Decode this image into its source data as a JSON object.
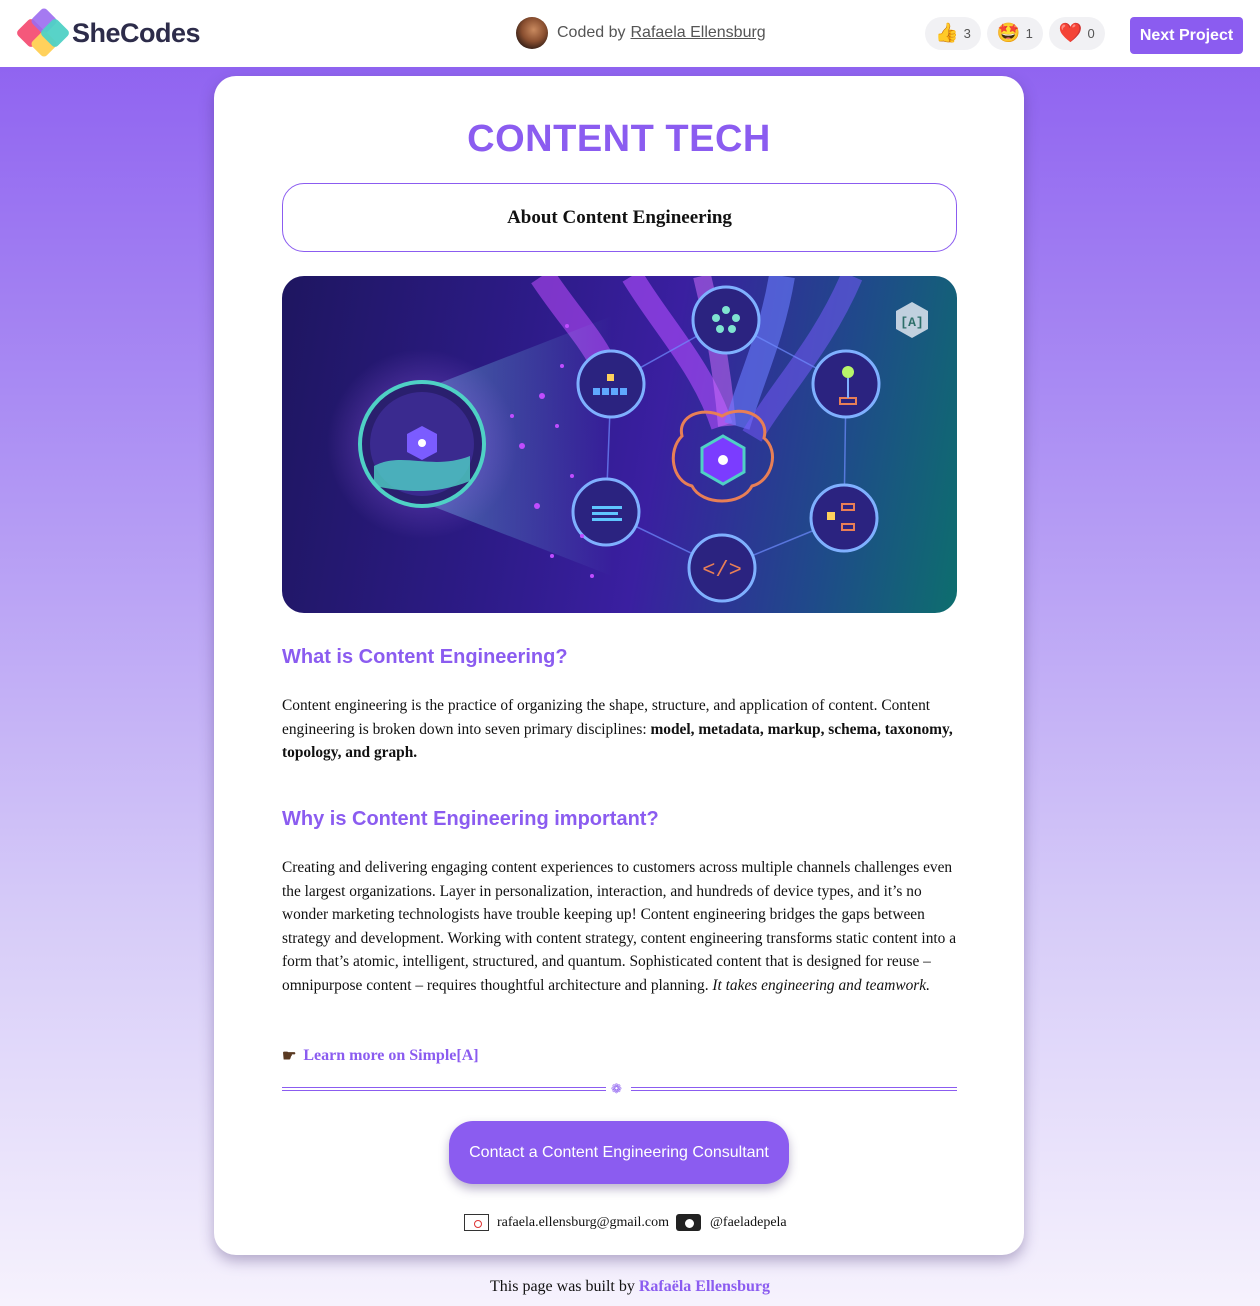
{
  "topbar": {
    "logo_text": "SheCodes",
    "coded_by_prefix": "Coded by",
    "author_name": "Rafaela Ellensburg",
    "reactions": [
      {
        "icon": "thumbs-up-icon",
        "glyph": "👍",
        "count": "3"
      },
      {
        "icon": "star-struck-icon",
        "glyph": "🤩",
        "count": "1"
      },
      {
        "icon": "heart-icon",
        "glyph": "❤️",
        "count": "0"
      }
    ],
    "next_label": "Next Project"
  },
  "card": {
    "title": "CONTENT TECH",
    "about_label": "About Content Engineering",
    "section1_heading": "What is Content Engineering?",
    "section1_text": "Content engineering is the practice of organizing the shape, structure, and application of content. Content engineering is broken down into seven primary disciplines: ",
    "section1_bold": "model, metadata, markup, schema, taxonomy, topology, and graph.",
    "section2_heading": "Why is Content Engineering important?",
    "section2_text": "Creating and delivering engaging content experiences to customers across multiple channels challenges even the largest organizations. Layer in personalization, interaction, and hundreds of device types, and it’s no wonder marketing technologists have trouble keeping up! Content engineering bridges the gaps between strategy and development. Working with content strategy, content engineering transforms static content into a form that’s atomic, intelligent, structured, and quantum. Sophisticated content that is designed for reuse – omnipurpose content – requires thoughtful architecture and planning. ",
    "section2_italic": "It takes engineering and teamwork.",
    "learn_more": "Learn more on Simple[A]",
    "cta_label": "Contact a Content Engineering Consultant",
    "email": "rafaela.ellensburg@gmail.com",
    "instagram": "@faeladepela",
    "hero_badge": "[A]"
  },
  "footer": {
    "prefix": "This page was built by",
    "author": "Rafaëla Ellensburg"
  },
  "colors": {
    "accent": "#8b5cf0",
    "text": "#111111"
  }
}
